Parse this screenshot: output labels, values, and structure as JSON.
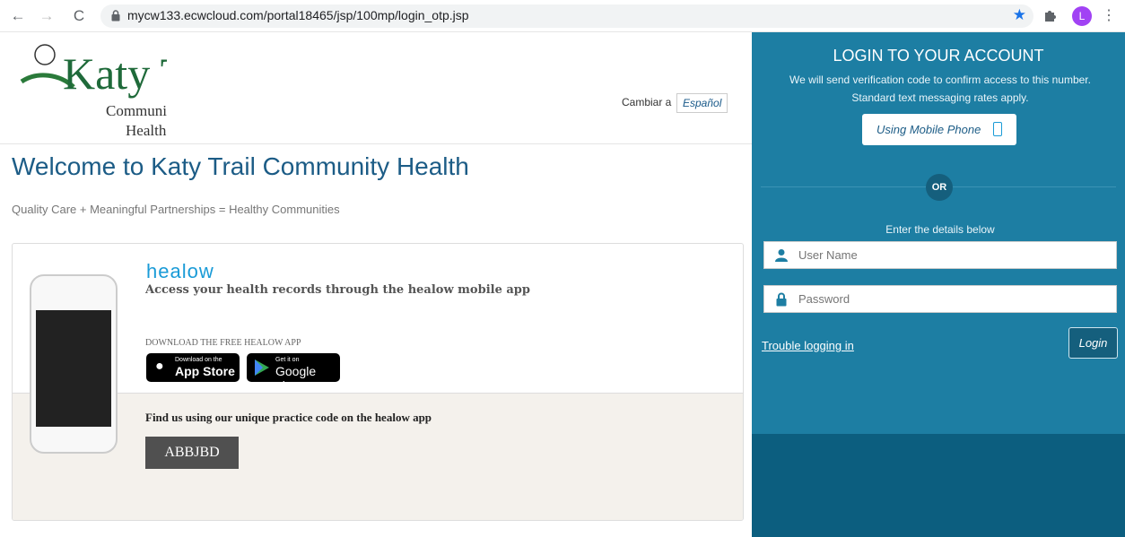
{
  "browser": {
    "url": "mycw133.ecwcloud.com/portal18465/jsp/100mp/login_otp.jsp",
    "back_icon": "←",
    "forward_icon": "→",
    "reload_icon": "C",
    "avatar_letter": "L"
  },
  "header": {
    "logo_text_main": "Katy Trail",
    "logo_text_sub1": "Community",
    "logo_text_sub2": "Health",
    "switch_label": "Cambiar a",
    "switch_button": "Español"
  },
  "main": {
    "title": "Welcome to Katy Trail Community Health",
    "tagline": "Quality Care + Meaningful Partnerships = Healthy Communities",
    "healow": {
      "logo": "healow",
      "headline": "Access your health records through the healow mobile app",
      "download_label": "DOWNLOAD THE FREE HEALOW APP",
      "app_store_small": "Download on the",
      "app_store_big": "App Store",
      "google_small": "Get it on",
      "google_big": "Google play",
      "find_text": "Find us using our unique practice code on the healow app",
      "practice_code": "ABBJBD"
    }
  },
  "login": {
    "title": "LOGIN TO YOUR ACCOUNT",
    "subtitle_line1": "We will send verification code to confirm access to this number.",
    "subtitle_line2": "Standard text messaging rates apply.",
    "mobile_button": "Using Mobile Phone",
    "or_label": "OR",
    "enter_details": "Enter the details below",
    "username_placeholder": "User Name",
    "password_placeholder": "Password",
    "trouble_link": "Trouble logging in",
    "login_button": "Login"
  },
  "colors": {
    "panel": "#1d7ea3",
    "panel_dark": "#0c5e7f",
    "title_blue": "#1c5c86",
    "healow_blue": "#1a9bd7"
  }
}
